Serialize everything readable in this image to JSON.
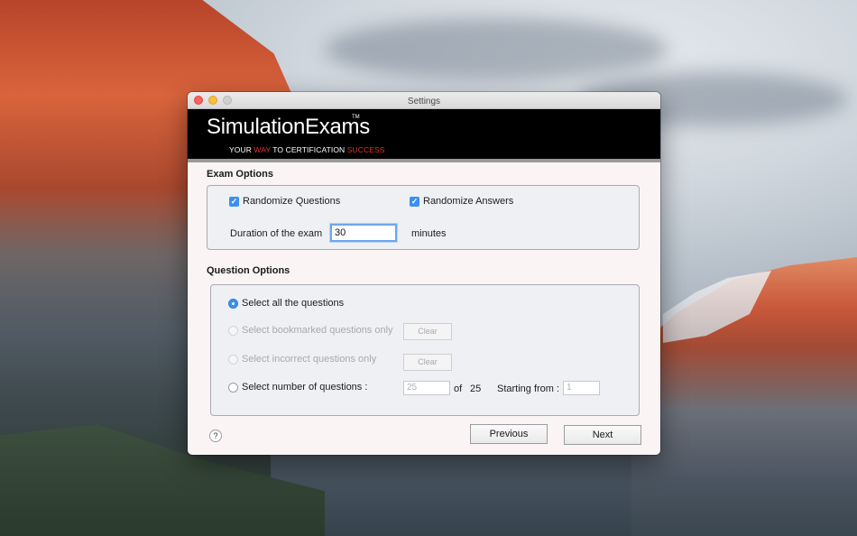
{
  "window": {
    "title": "Settings"
  },
  "banner": {
    "brand": "SimulationExams",
    "trademark": "TM",
    "tagline": {
      "part1": "YOUR ",
      "part2": "WAY",
      "part3": " TO CERTIFICATION ",
      "part4": "SUCCESS"
    },
    "accent_color": "#e0352b"
  },
  "exam_options": {
    "title": "Exam Options",
    "randomize_questions": {
      "label": "Randomize Questions",
      "checked": true
    },
    "randomize_answers": {
      "label": "Randomize Answers",
      "checked": true
    },
    "duration_label": "Duration of the exam",
    "duration_value": "30",
    "duration_unit": "minutes"
  },
  "question_options": {
    "title": "Question Options",
    "select_all": {
      "label": "Select all the questions",
      "selected": true
    },
    "bookmarked": {
      "label": "Select bookmarked questions only",
      "button": "Clear"
    },
    "incorrect": {
      "label": "Select incorrect questions only",
      "button": "Clear"
    },
    "number": {
      "label": "Select number of questions :",
      "count_placeholder": "25",
      "of_label": "of",
      "total": "25",
      "starting_label": "Starting from :",
      "start_placeholder": "1"
    }
  },
  "footer": {
    "help": "?",
    "previous": "Previous",
    "next": "Next"
  },
  "colors": {
    "checkbox_blue": "#3a8ff0",
    "focus_ring": "#6fa6ee"
  }
}
